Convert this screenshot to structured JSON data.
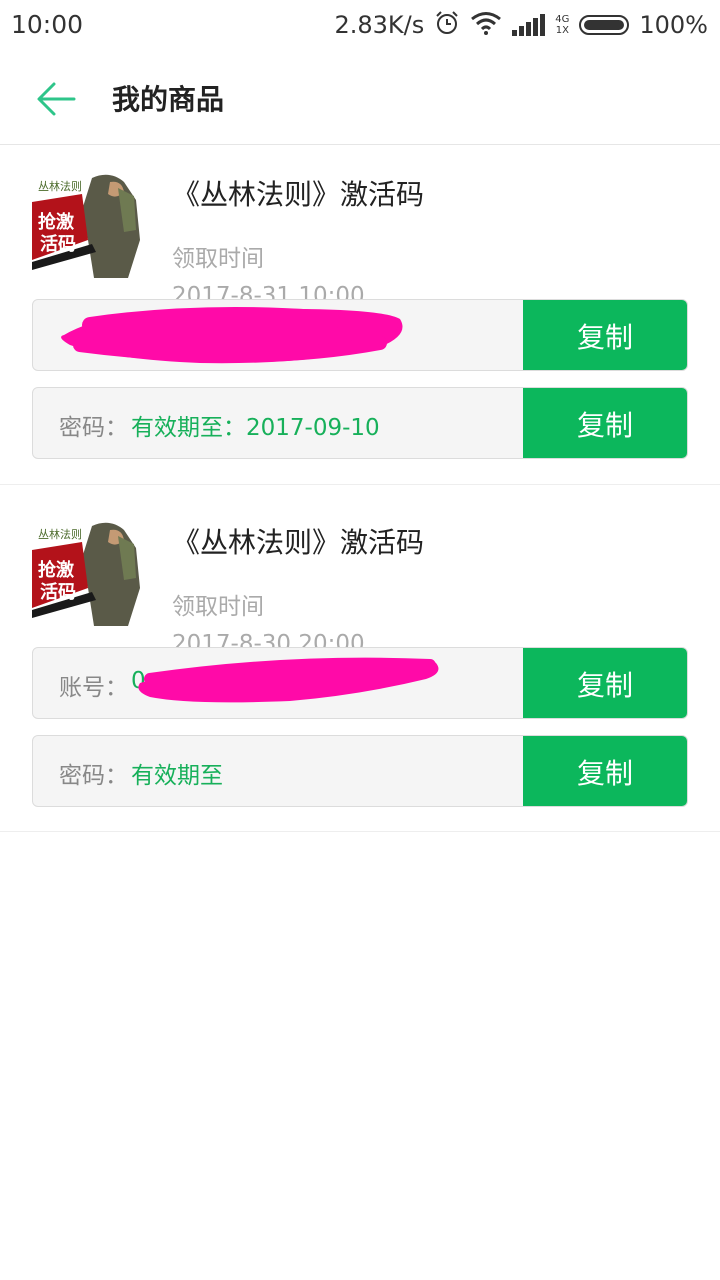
{
  "status_bar": {
    "time": "10:00",
    "net_speed": "2.83K/s",
    "network_type": "4G",
    "sim_label": "1X",
    "battery": "100%",
    "icons": [
      "alarm-icon",
      "wifi-icon",
      "signal-icon",
      "battery-icon"
    ]
  },
  "header": {
    "title": "我的商品",
    "back_icon": "arrow-left-icon",
    "accent_color": "#2ec58a"
  },
  "items": [
    {
      "title": "《丛林法则》激活码",
      "claim_label": "领取时间",
      "claim_time": "2017-8-31 10:00",
      "fields": [
        {
          "label": "",
          "value": "",
          "copy_label": "复制"
        },
        {
          "label": "密码：",
          "value": "有效期至：2017-09-10",
          "copy_label": "复制"
        }
      ]
    },
    {
      "title": "《丛林法则》激活码",
      "claim_label": "领取时间",
      "claim_time": "2017-8-30 20:00",
      "fields": [
        {
          "label": "账号：",
          "value": "0",
          "copy_label": "复制"
        },
        {
          "label": "密码：",
          "value": "有效期至",
          "copy_label": "复制"
        }
      ]
    }
  ],
  "colors": {
    "button_green": "#0cb75c",
    "value_green": "#17b05a",
    "redaction_magenta": "#ff0aa8"
  }
}
